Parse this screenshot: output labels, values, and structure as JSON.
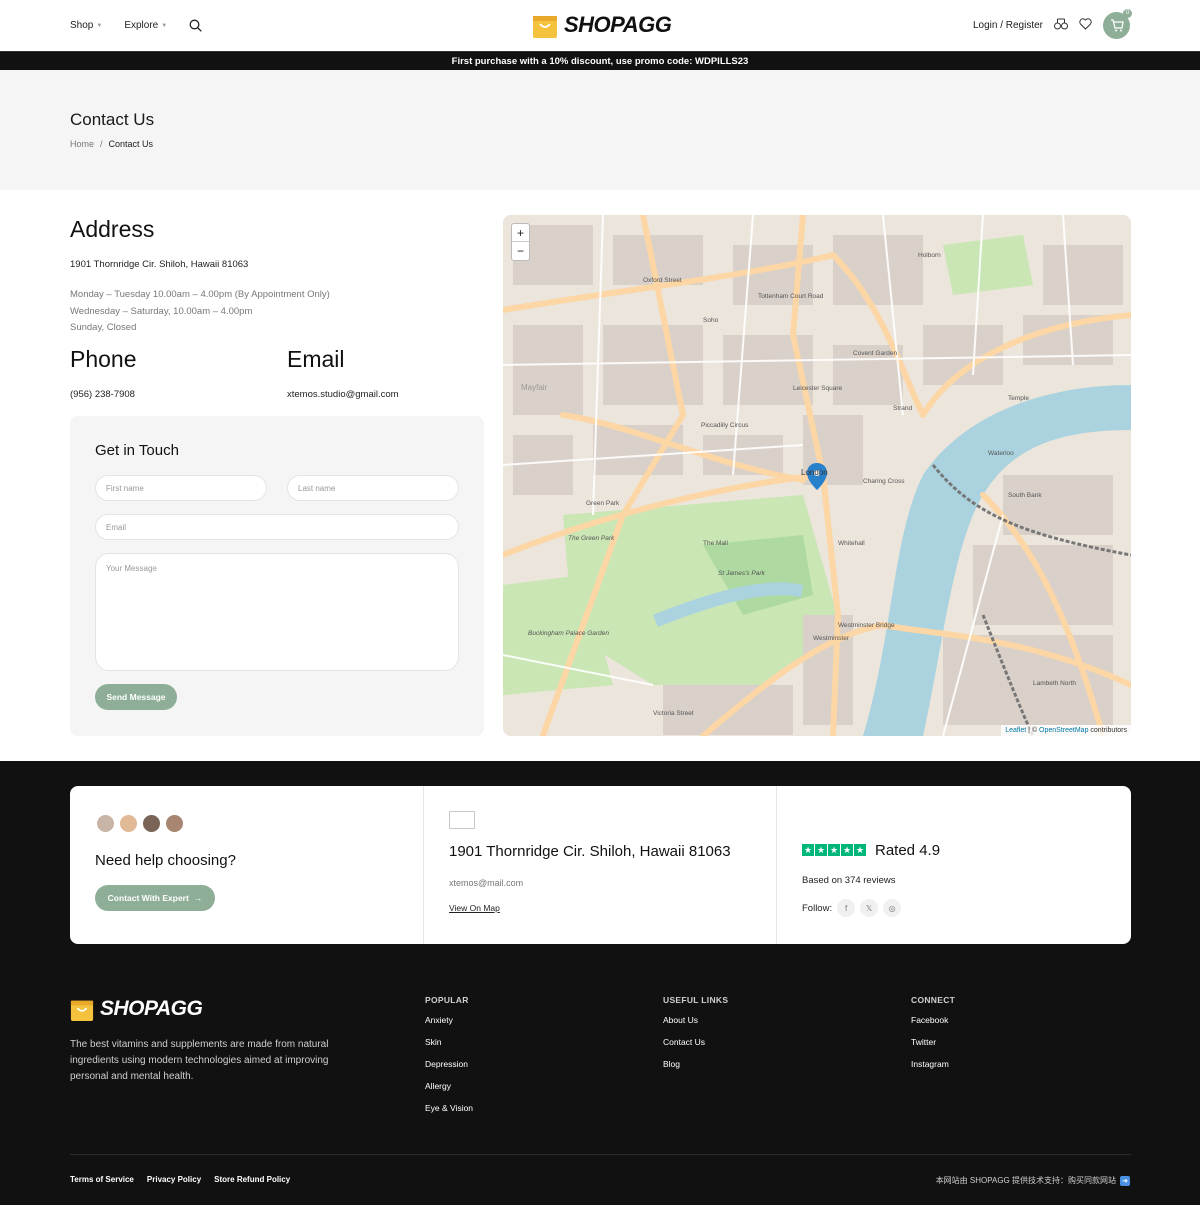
{
  "header": {
    "nav": [
      {
        "label": "Shop"
      },
      {
        "label": "Explore"
      }
    ],
    "logo_text": "SHOPAGG",
    "login_label": "Login / Register",
    "cart_count": "0"
  },
  "promo": {
    "text": "First purchase with a 10% discount, use promo code: WDPILLS23"
  },
  "title_band": {
    "title": "Contact Us",
    "breadcrumb": {
      "home": "Home",
      "separator": "/",
      "current": "Contact Us"
    }
  },
  "contact": {
    "address_heading": "Address",
    "address": "1901 Thornridge Cir. Shiloh, Hawaii 81063",
    "hours": [
      "Monday – Tuesday 10.00am – 4.00pm (By Appointment Only)",
      "Wednesday – Saturday, 10.00am – 4.00pm",
      "Sunday, Closed"
    ],
    "phone_heading": "Phone",
    "phone": "(956) 238-7908",
    "email_heading": "Email",
    "email": "xtemos.studio@gmail.com"
  },
  "form": {
    "title": "Get in Touch",
    "first_name_placeholder": "First name",
    "last_name_placeholder": "Last name",
    "email_placeholder": "Email",
    "message_placeholder": "Your Message",
    "submit_label": "Send Message"
  },
  "map": {
    "zoom_in": "+",
    "zoom_out": "−",
    "attribution_leaflet": "Leaflet",
    "attribution_sep": " | © ",
    "attribution_osm": "OpenStreetMap",
    "attribution_tail": " contributors",
    "labels": [
      "Oxford Street",
      "Soho",
      "Mayfair",
      "Piccadilly Circus",
      "Leicester Square",
      "Covent Garden",
      "London",
      "Charing Cross",
      "Green Park",
      "The Green Park",
      "St James's Park",
      "Buckingham Palace Garden",
      "Westminster",
      "Waterloo",
      "South Bank",
      "Temple",
      "Holborn",
      "Tottenham Court Road",
      "Lambeth North",
      "Westminster Bridge",
      "Victoria Street",
      "The Mall",
      "Strand",
      "Whitehall"
    ]
  },
  "help_card": {
    "need_help": "Need help choosing?",
    "expert_label": "Contact With Expert",
    "address": "1901 Thornridge Cir. Shiloh, Hawaii 81063",
    "email": "xtemos@mail.com",
    "view_map": "View On Map",
    "rated": "Rated 4.9",
    "reviews": "Based on 374 reviews",
    "follow": "Follow:",
    "rating_stars": 5
  },
  "footer": {
    "logo_text": "SHOPAGG",
    "description": "The best vitamins and supplements are made from natural ingredients using modern technologies aimed at improving personal and mental health.",
    "columns": [
      {
        "heading": "POPULAR",
        "links": [
          "Anxiety",
          "Skin",
          "Depression",
          "Allergy",
          "Eye & Vision"
        ]
      },
      {
        "heading": "USEFUL LINKS",
        "links": [
          "About Us",
          "Contact Us",
          "Blog"
        ]
      },
      {
        "heading": "CONNECT",
        "links": [
          "Facebook",
          "Twitter",
          "Instagram"
        ]
      }
    ],
    "legal": [
      "Terms of Service",
      "Privacy Policy",
      "Store Refund Policy"
    ],
    "powered": "本网站由 SHOPAGG 提供技术支持：购买同款网站"
  },
  "colors": {
    "accent": "#8fae97",
    "dark_bg": "#111111",
    "logo_yellow": "#f5c23e",
    "trustpilot": "#00b67a"
  }
}
